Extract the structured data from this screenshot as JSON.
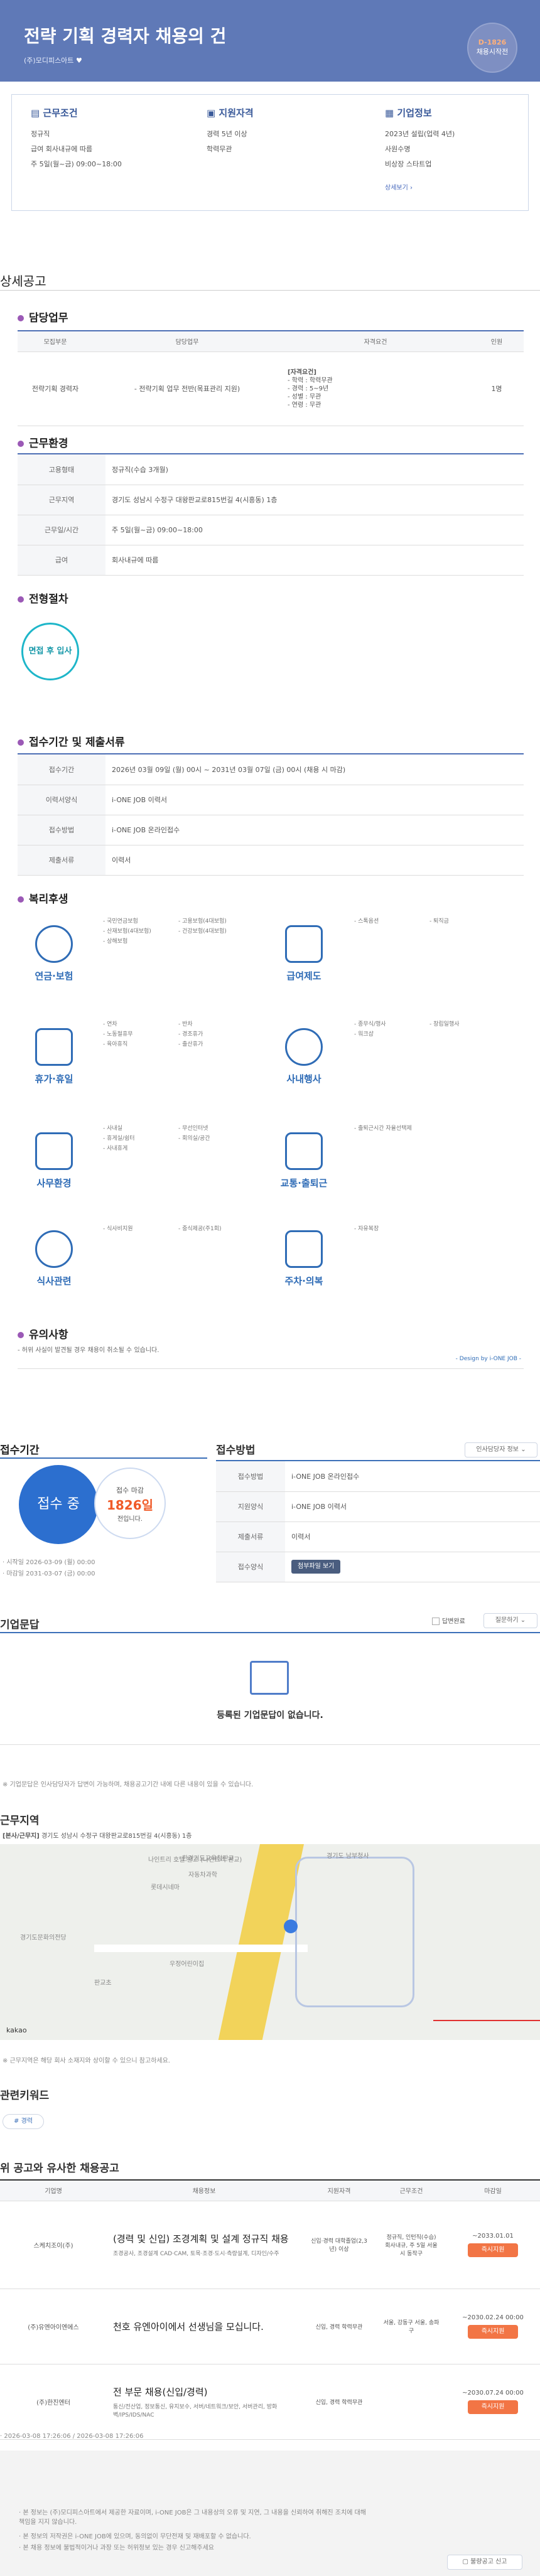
{
  "header": {
    "title": "전략 기획 경력자 채용의 건",
    "company": "(주)모디피스아트",
    "dday_line1": "D-1826",
    "dday_line2": "채용시작전"
  },
  "summary": {
    "conditions": {
      "title": "근무조건",
      "lines": [
        "정규직",
        "급여 회사내규에 따름",
        "주 5일(월~금) 09:00~18:00"
      ]
    },
    "qualifications": {
      "title": "지원자격",
      "lines": [
        "경력 5년 이상",
        "학력무관"
      ]
    },
    "company_info": {
      "title": "기업정보",
      "lines": [
        "2023년 설립(업력 4년)",
        "사원수명",
        "비상장 스타트업"
      ],
      "link": "상세보기"
    }
  },
  "detail": {
    "section_title": "상세공고",
    "duties": {
      "title": "담당업무",
      "headers": [
        "모집부문",
        "담당업무",
        "자격요건",
        "인원"
      ],
      "row": {
        "division": "전략기획 경력자",
        "duty": "- 전략기획 업무 전반(목표관리 지원)",
        "req_title": "[자격요건]",
        "req_lines": [
          "- 학력 : 학력무관",
          "- 경력 : 5~9년",
          "- 성별 : 무관",
          "- 연령 : 무관"
        ],
        "count": "1명"
      }
    },
    "environment": {
      "title": "근무환경",
      "rows": [
        {
          "label": "고용형태",
          "value": "정규직(수습 3개월)"
        },
        {
          "label": "근무지역",
          "value": "경기도 성남시 수정구 대왕판교로815번길 4(시흥동) 1층"
        },
        {
          "label": "근무일/시간",
          "value": "주 5일(월~금) 09:00~18:00"
        },
        {
          "label": "급여",
          "value": "회사내규에 따름"
        }
      ]
    },
    "process": {
      "title": "전형절차",
      "step": "면접 후 입사"
    },
    "apply": {
      "title": "접수기간 및 제출서류",
      "rows": [
        {
          "label": "접수기간",
          "value": "2026년 03월 09일 (월) 00시 ~ 2031년 03월 07일 (금) 00시 (채용 시 마감)"
        },
        {
          "label": "이력서양식",
          "value": "i-ONE JOB 이력서"
        },
        {
          "label": "접수방법",
          "value": "i-ONE JOB 온라인접수"
        },
        {
          "label": "제출서류",
          "value": "이력서"
        }
      ]
    },
    "benefits": {
      "title": "복리후생",
      "items": [
        {
          "name": "연금·보험",
          "col1": [
            "- 국민연금보험",
            "- 산재보험(4대보험)",
            "- 상해보험"
          ],
          "col2": [
            "- 고용보험(4대보험)",
            "- 건강보험(4대보험)"
          ]
        },
        {
          "name": "급여제도",
          "col1": [
            "- 스톡옵션"
          ],
          "col2": [
            "- 퇴직금"
          ]
        },
        {
          "name": "휴가·휴일",
          "col1": [
            "- 연차",
            "- 노동절휴무",
            "- 육아휴직"
          ],
          "col2": [
            "- 반차",
            "- 경조휴가",
            "- 출산휴가"
          ]
        },
        {
          "name": "사내행사",
          "col1": [
            "- 종무식/행사",
            "- 워크샵"
          ],
          "col2": [
            "- 창립일행사"
          ]
        },
        {
          "name": "사무환경",
          "col1": [
            "- 사내실",
            "- 휴게실/쉼터",
            "- 사내휴게"
          ],
          "col2": [
            "- 무선인터넷",
            "- 회의실/공간"
          ]
        },
        {
          "name": "교통·출퇴근",
          "col1": [
            "- 출퇴근시간 자율선택제"
          ],
          "col2": []
        },
        {
          "name": "식사관련",
          "col1": [
            "- 식사비지원"
          ],
          "col2": [
            "- 중식제공(주1회)"
          ]
        },
        {
          "name": "주차·의복",
          "col1": [
            "- 자유복장"
          ],
          "col2": []
        }
      ]
    },
    "notice": {
      "title": "유의사항",
      "text": "- 허위 사실이 발견될 경우 채용이 취소될 수 있습니다.",
      "design": "- Design by i-ONE JOB -"
    }
  },
  "apply_box": {
    "period_title": "접수기간",
    "status": "접수 중",
    "remain_label": "접수 마감",
    "remain_days": "1826일",
    "remain_suffix": "전입니다.",
    "start": "시작일 2026-03-09 (월) 00:00",
    "end": "마감일 2031-03-07 (금) 00:00",
    "method_title": "접수방법",
    "manager_btn": "인사담당자 정보",
    "rows": [
      {
        "label": "접수방법",
        "value": "i-ONE JOB 온라인접수"
      },
      {
        "label": "지원양식",
        "value": "i-ONE JOB 이력서"
      },
      {
        "label": "제출서류",
        "value": "이력서"
      },
      {
        "label": "접수양식",
        "value": "첨부파일 보기"
      }
    ]
  },
  "qna": {
    "title": "기업문답",
    "checkbox_label": "답변완료",
    "sort_label": "질문하기",
    "empty": "등록된 기업문답이 없습니다.",
    "notice": "※ 기업문답은 인사담당자가 답변이 가능하며, 채용공고기간 내에 다른 내용이 있을 수 있습니다."
  },
  "location": {
    "title": "근무지역",
    "address_label": "[본사/근무지]",
    "address": "경기도 성남시 수정구 대왕판교로815번길 4(시흥동) 1층",
    "map_labels": [
      "한경기도교육청판교",
      "자동차과학",
      "경기도 남부청사",
      "경기도문화의전당",
      "나인트리 호텔 판교 (나인트리 판교)",
      "롯데시네마",
      "우정어린이집",
      "판교초"
    ],
    "map_footer": "※ 근무지역은 해당 회사 소재지와 상이할 수 있으니 참고하세요.",
    "map_brand": "kakao"
  },
  "keywords": {
    "title": "관련키워드",
    "items": [
      "# 경력"
    ]
  },
  "similar": {
    "title": "위 공고와 유사한 채용공고",
    "headers": [
      "기업명",
      "채용정보",
      "지원자격",
      "근무조건",
      "마감일"
    ],
    "rows": [
      {
        "company": "스케치조이(주)",
        "title": "(경력 및 신입) 조경계획 및 설계 정규직 채용",
        "desc": "조경공사, 조경설계 CAD·CAM, 토목·조경·도시·측량설계, 디자인/수주",
        "qual": "신입·경력 대학졸업(2,3년) 이상",
        "cond": "정규직, 인턴직(수습) 회사내규, 주 5일 서울시 동작구",
        "date": "~2033.01.01",
        "btn": "즉시지원"
      },
      {
        "company": "(주)유엔아이엔에스",
        "title": "천호 유엔아이에서 선생님을 모십니다.",
        "desc": "",
        "qual": "신입, 경력 학력무관",
        "cond": "서울, 강동구 서울, 송파구",
        "date": "~2030.02.24 00:00",
        "btn": "즉시지원"
      },
      {
        "company": "(주)한진엔터",
        "title": "전 부문 채용(신입/경력)",
        "desc": "통신/전산업, 정보통신, 유지보수, 서버/네트워크/보안, 서버관리, 방화벽/IPS/IDS/NAC",
        "qual": "신입, 경력 학력무관",
        "cond": "",
        "date": "~2030.07.24 00:00",
        "btn": "즉시지원"
      }
    ]
  },
  "footer": {
    "dates": "· 2026-03-08 17:26:06 / 2026-03-08 17:26:06",
    "notes": [
      "본 정보는 (주)모디피스아트에서 제공한 자료이며, i-ONE JOB은 그 내용상의 오류 및 지연, 그 내용을 신뢰하여 취해진 조치에 대해 책임을 지지 않습니다.",
      "본 정보의 저작권은 i-ONE JOB에 있으며, 동의없이 무단전재 및 재배포할 수 없습니다.",
      "본 채용 정보에 불법적이거나 과장 또는 허위정보 있는 경우 신고해주세요"
    ],
    "report_btn": "불량공고 신고"
  }
}
